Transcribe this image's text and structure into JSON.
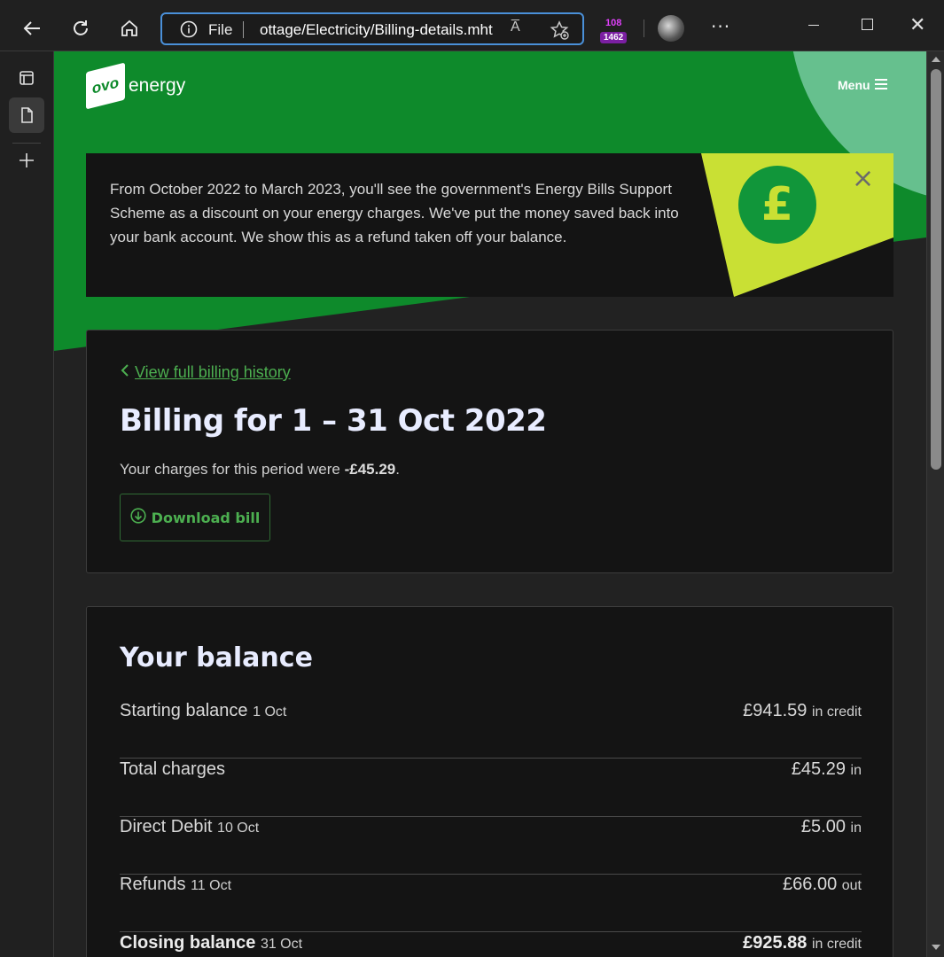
{
  "browser": {
    "address_prefix": "File",
    "url": "ottage/Electricity/Billing-details.mht",
    "read_aloud": "A̅",
    "extension_count_top": "108",
    "extension_count_bottom": "1462",
    "more_label": "···"
  },
  "site": {
    "logo_mark": "ovo",
    "logo_word": "energy",
    "menu_label": "Menu"
  },
  "banner": {
    "text": "From October 2022 to March 2023, you'll see the government's Energy Bills Support Scheme as a discount on your energy charges. We've put the money saved back into your bank account. We show this as a refund taken off your balance.",
    "symbol": "£",
    "close": "×"
  },
  "billing": {
    "back_link": "View full billing history",
    "title": "Billing for 1 – 31 Oct 2022",
    "charges_prefix": "Your charges for this period were ",
    "charges_amount": "-£45.29",
    "charges_suffix": ".",
    "download_label": "Download bill"
  },
  "balance": {
    "title": "Your balance",
    "rows": [
      {
        "label": "Starting balance",
        "date": "1 Oct",
        "amount": "£941.59",
        "note": "in credit"
      },
      {
        "label": "Total charges",
        "date": "",
        "amount": "£45.29",
        "note": "in"
      },
      {
        "label": "Direct Debit",
        "date": "10 Oct",
        "amount": "£5.00",
        "note": "in"
      },
      {
        "label": "Refunds",
        "date": "11 Oct",
        "amount": "£66.00",
        "note": "out"
      },
      {
        "label": "Closing balance",
        "date": "31 Oct",
        "amount": "£925.88",
        "note": "in credit"
      }
    ]
  },
  "colors": {
    "brand_green": "#0e8a2b",
    "accent_lime": "#c9e034",
    "link_green": "#4caf50"
  }
}
